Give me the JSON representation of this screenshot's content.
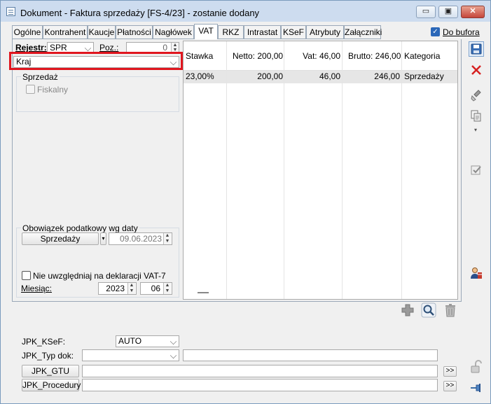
{
  "window": {
    "title": "Dokument - Faktura sprzedaży [FS-4/23]  - zostanie dodany",
    "btn_min": "▭",
    "btn_max": "▣",
    "btn_close": "✕"
  },
  "tabs": [
    "Ogólne",
    "Kontrahent",
    "Kaucje",
    "Płatności",
    "Nagłówek",
    "VAT",
    "RKZ",
    "Intrastat",
    "KSeF",
    "Atrybuty",
    "Załączniki"
  ],
  "do_bufora": {
    "label": "Do bufora",
    "checked": true
  },
  "left": {
    "rejestr_label": "Rejestr:",
    "rejestr_value": "SPR",
    "poz_label": "Poz.:",
    "poz_value": "0",
    "kraj_value": "Kraj",
    "sprzedaz_group": "Sprzedaż",
    "fiskalny_label": "Fiskalny",
    "obowiazek_group": "Obowiązek podatkowy wg daty",
    "sprzedazy_button": "Sprzedaży",
    "data_value": "09.06.2023",
    "nie_uwzgledniaj_label": "Nie uwzględniaj na deklaracji VAT-7",
    "miesiac_label": "Miesiąc:",
    "rok_value": "2023",
    "miesiac_value": "06"
  },
  "vat_table": {
    "columns": [
      "Stawka",
      "Netto: 200,00",
      "Vat: 46,00",
      "Brutto: 246,00",
      "Kategoria"
    ],
    "rows": [
      [
        "23,00%",
        "200,00",
        "46,00",
        "246,00",
        "Sprzedaży"
      ]
    ]
  },
  "bottom": {
    "jpk_ksef_label": "JPK_KSeF:",
    "jpk_ksef_value": "AUTO",
    "jpk_typ_label": "JPK_Typ dok:",
    "jpk_gtu_button": "JPK_GTU",
    "jpk_procedury_button": "JPK_Procedury",
    "more_label": ">>"
  },
  "toolbar": [
    "save-icon",
    "delete-icon",
    "clean-icon",
    "copy-icon",
    "check-icon",
    "users-icon",
    "lock-icon",
    "pin-icon"
  ],
  "colors": {
    "highlight": "#e0161f",
    "accent": "#2a67b8",
    "table_selected": "#e6e6e6"
  }
}
